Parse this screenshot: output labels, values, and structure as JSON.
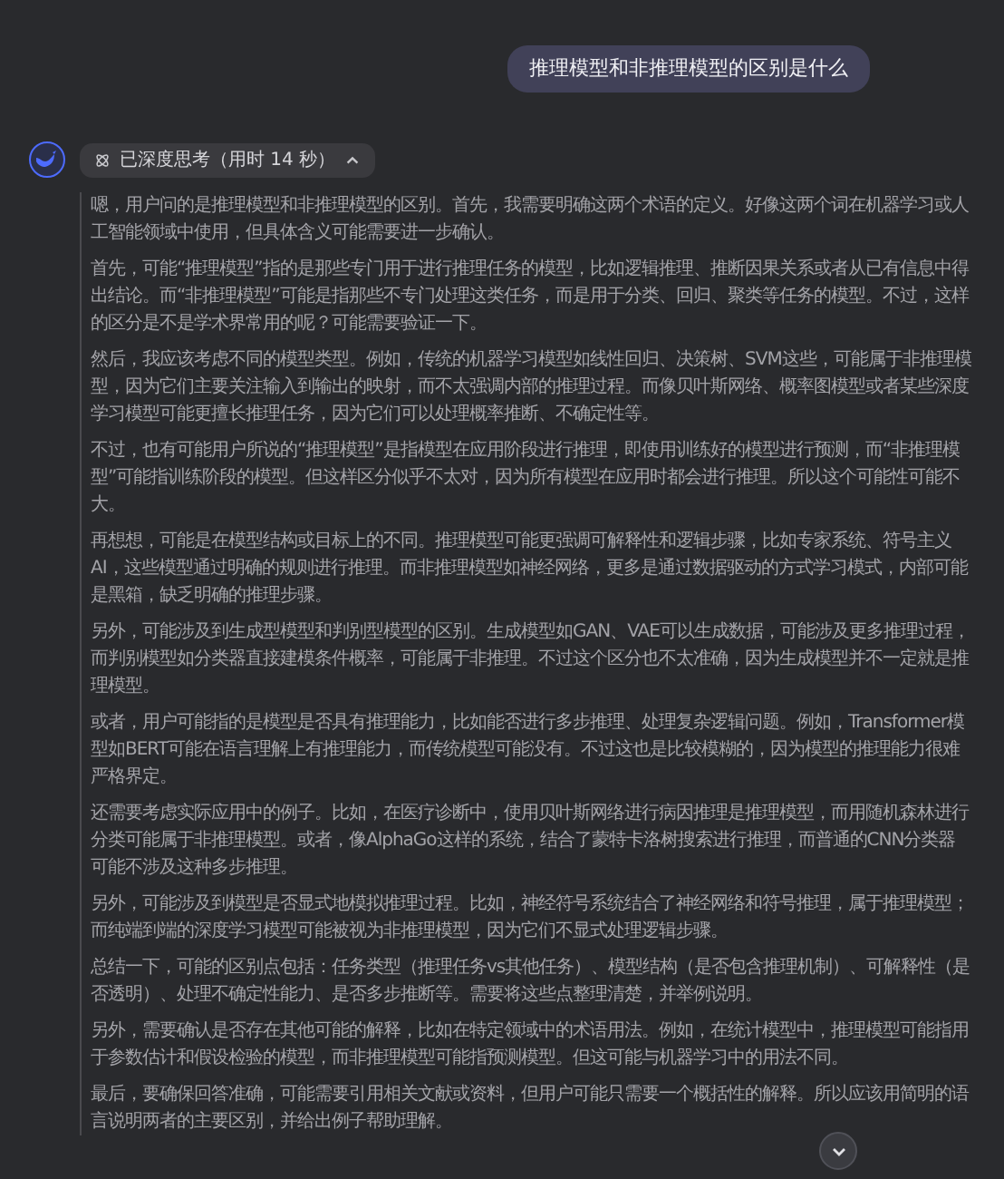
{
  "user_message": "推理模型和非推理模型的区别是什么",
  "thinking": {
    "label": "已深度思考（用时 14 秒）",
    "expanded": true,
    "paragraphs": [
      "嗯，用户问的是推理模型和非推理模型的区别。首先，我需要明确这两个术语的定义。好像这两个词在机器学习或人工智能领域中使用，但具体含义可能需要进一步确认。",
      "首先，可能“推理模型”指的是那些专门用于进行推理任务的模型，比如逻辑推理、推断因果关系或者从已有信息中得出结论。而“非推理模型”可能是指那些不专门处理这类任务，而是用于分类、回归、聚类等任务的模型。不过，这样的区分是不是学术界常用的呢？可能需要验证一下。",
      "然后，我应该考虑不同的模型类型。例如，传统的机器学习模型如线性回归、决策树、SVM这些，可能属于非推理模型，因为它们主要关注输入到输出的映射，而不太强调内部的推理过程。而像贝叶斯网络、概率图模型或者某些深度学习模型可能更擅长推理任务，因为它们可以处理概率推断、不确定性等。",
      "不过，也有可能用户所说的“推理模型”是指模型在应用阶段进行推理，即使用训练好的模型进行预测，而“非推理模型”可能指训练阶段的模型。但这样区分似乎不太对，因为所有模型在应用时都会进行推理。所以这个可能性可能不大。",
      "再想想，可能是在模型结构或目标上的不同。推理模型可能更强调可解释性和逻辑步骤，比如专家系统、符号主义AI，这些模型通过明确的规则进行推理。而非推理模型如神经网络，更多是通过数据驱动的方式学习模式，内部可能是黑箱，缺乏明确的推理步骤。",
      "另外，可能涉及到生成型模型和判别型模型的区别。生成模型如GAN、VAE可以生成数据，可能涉及更多推理过程，而判别模型如分类器直接建模条件概率，可能属于非推理。不过这个区分也不太准确，因为生成模型并不一定就是推理模型。",
      "或者，用户可能指的是模型是否具有推理能力，比如能否进行多步推理、处理复杂逻辑问题。例如，Transformer模型如BERT可能在语言理解上有推理能力，而传统模型可能没有。不过这也是比较模糊的，因为模型的推理能力很难严格界定。",
      "还需要考虑实际应用中的例子。比如，在医疗诊断中，使用贝叶斯网络进行病因推理是推理模型，而用随机森林进行分类可能属于非推理模型。或者，像AlphaGo这样的系统，结合了蒙特卡洛树搜索进行推理，而普通的CNN分类器可能不涉及这种多步推理。",
      "另外，可能涉及到模型是否显式地模拟推理过程。比如，神经符号系统结合了神经网络和符号推理，属于推理模型；而纯端到端的深度学习模型可能被视为非推理模型，因为它们不显式处理逻辑步骤。",
      "总结一下，可能的区别点包括：任务类型（推理任务vs其他任务）、模型结构（是否包含推理机制）、可解释性（是否透明）、处理不确定性能力、是否多步推断等。需要将这些点整理清楚，并举例说明。",
      "另外，需要确认是否存在其他可能的解释，比如在特定领域中的术语用法。例如，在统计模型中，推理模型可能指用于参数估计和假设检验的模型，而非推理模型可能指预测模型。但这可能与机器学习中的用法不同。",
      "最后，要确保回答准确，可能需要引用相关文献或资料，但用户可能只需要一个概括性的解释。所以应该用简明的语言说明两者的主要区别，并给出例子帮助理解。"
    ]
  }
}
